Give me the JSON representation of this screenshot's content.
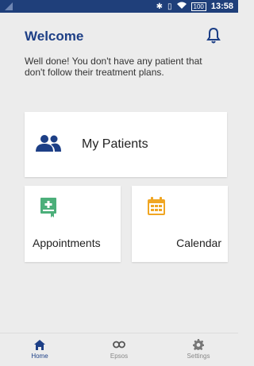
{
  "status_bar": {
    "time": "13:58",
    "battery": "100",
    "icons": [
      "signal-icon",
      "bluetooth-icon",
      "vibrate-icon",
      "wifi-icon",
      "battery-icon"
    ]
  },
  "header": {
    "title": "Welcome",
    "message": "Well done! You don't have any patient that don't follow their treatment plans.",
    "notification_icon": "bell-icon"
  },
  "cards": {
    "patients": {
      "label": "My Patients",
      "icon": "users-icon",
      "color": "#1d3f86"
    },
    "appointments": {
      "label": "Appointments",
      "icon": "appointment-icon",
      "color": "#4caf7a"
    },
    "calendar": {
      "label": "Calendar",
      "icon": "calendar-icon",
      "color": "#f0a623"
    }
  },
  "bottom_nav": {
    "items": [
      {
        "label": "Home",
        "icon": "home-icon",
        "active": true
      },
      {
        "label": "Epsos",
        "icon": "infinity-icon",
        "active": false
      },
      {
        "label": "Settings",
        "icon": "gear-icon",
        "active": false
      }
    ]
  },
  "colors": {
    "primary": "#1d3f86",
    "status_bar": "#1f3f7a",
    "background": "#ececec"
  }
}
